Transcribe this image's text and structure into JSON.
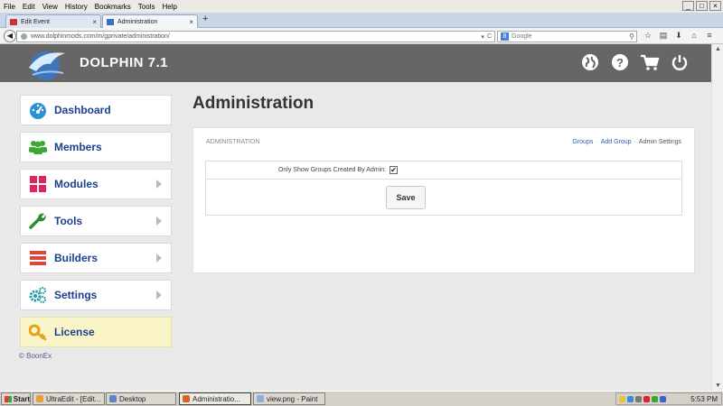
{
  "browser": {
    "menus": [
      "File",
      "Edit",
      "View",
      "History",
      "Bookmarks",
      "Tools",
      "Help"
    ],
    "tabs": [
      {
        "label": "Edit Event",
        "close": "×"
      },
      {
        "label": "Administration",
        "close": "×"
      }
    ],
    "new_tab": "+",
    "url": "www.dolphinmods.com/m/gprivate/administration/",
    "search_placeholder": "Google",
    "window_controls": [
      "_",
      "□",
      "×"
    ]
  },
  "site": {
    "brand": "DOLPHIN 7.1",
    "header_icons": [
      "globe-icon",
      "help-icon",
      "cart-icon",
      "power-icon"
    ],
    "menu": [
      {
        "label": "Dashboard",
        "icon": "dashboard-icon",
        "color": "#2a93d5",
        "chevron": false
      },
      {
        "label": "Members",
        "icon": "members-icon",
        "color": "#3aaa35",
        "chevron": false
      },
      {
        "label": "Modules",
        "icon": "modules-icon",
        "color": "#e0245e",
        "chevron": true
      },
      {
        "label": "Tools",
        "icon": "wrench-icon",
        "color": "#2e8b2e",
        "chevron": true
      },
      {
        "label": "Builders",
        "icon": "builders-icon",
        "color": "#e0453a",
        "chevron": true
      },
      {
        "label": "Settings",
        "icon": "settings-icon",
        "color": "#1b9aa8",
        "chevron": true
      },
      {
        "label": "License",
        "icon": "key-icon",
        "color": "#e8a21a",
        "chevron": false
      }
    ],
    "copyright": "© BoonEx"
  },
  "main": {
    "title": "Administration",
    "panel_title": "ADMINISTRATION",
    "links": [
      "Groups",
      "Add Group"
    ],
    "current_link": "Admin Settings",
    "option_label": "Only Show Groups Created By Admin:",
    "option_checked": true,
    "check_mark": "✔",
    "save_label": "Save"
  },
  "taskbar": {
    "start": "Start",
    "tasks": [
      "UltraEdit - [Edit...",
      "Desktop",
      "Administratio...",
      "view.png - Paint"
    ],
    "clock": "5:53 PM"
  },
  "colors": {
    "header": "#666666",
    "link": "#2f5bb7",
    "menu_label": "#1c3f8e",
    "license_bg": "#f9f5c8"
  }
}
